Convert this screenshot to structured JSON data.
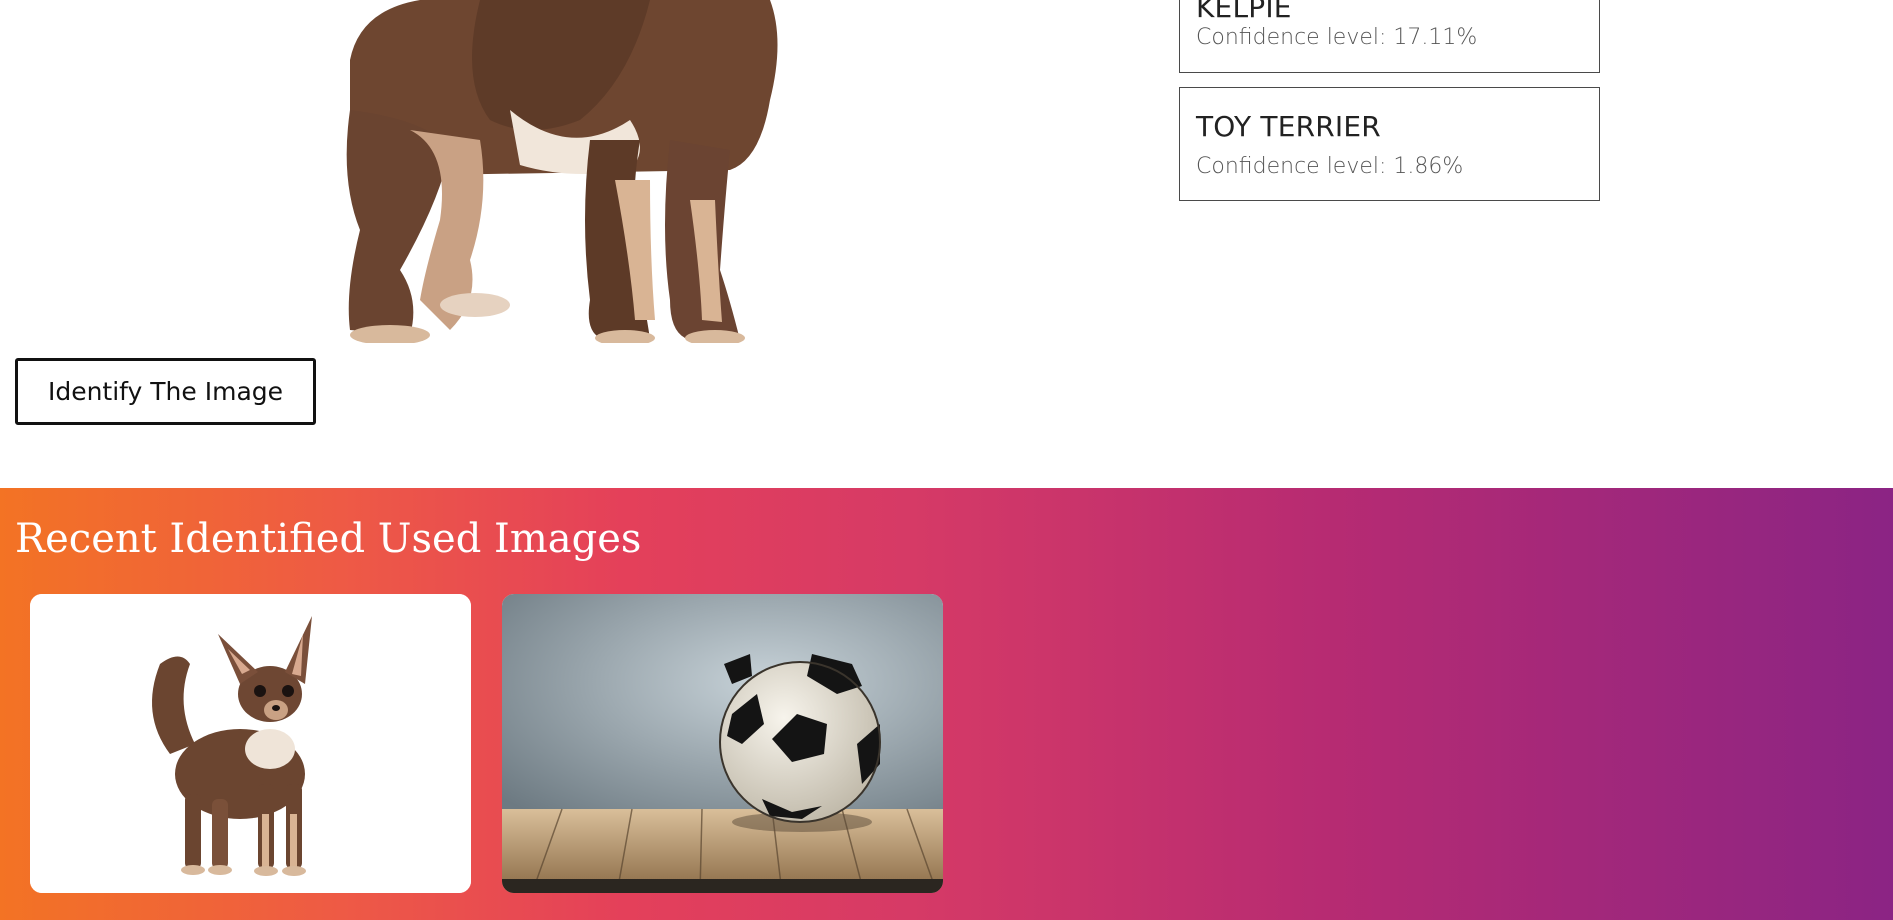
{
  "main_image": {
    "alt": "chihuahua",
    "icon": "chihuahua-photo"
  },
  "results": [
    {
      "name": "KELPIE",
      "confidence": "Confidence level: 17.11%"
    },
    {
      "name": "TOY TERRIER",
      "confidence": "Confidence level: 1.86%"
    }
  ],
  "identify_button": {
    "label": "Identify The Image"
  },
  "recent": {
    "title": "Recent Identified Used Images",
    "items": [
      {
        "alt": "chihuahua",
        "icon": "chihuahua-photo"
      },
      {
        "alt": "soccer ball",
        "icon": "soccer-ball-photo"
      }
    ]
  },
  "colors": {
    "gradient_start": "#f37324",
    "gradient_mid": "#e4405a",
    "gradient_end": "#8b2484"
  }
}
